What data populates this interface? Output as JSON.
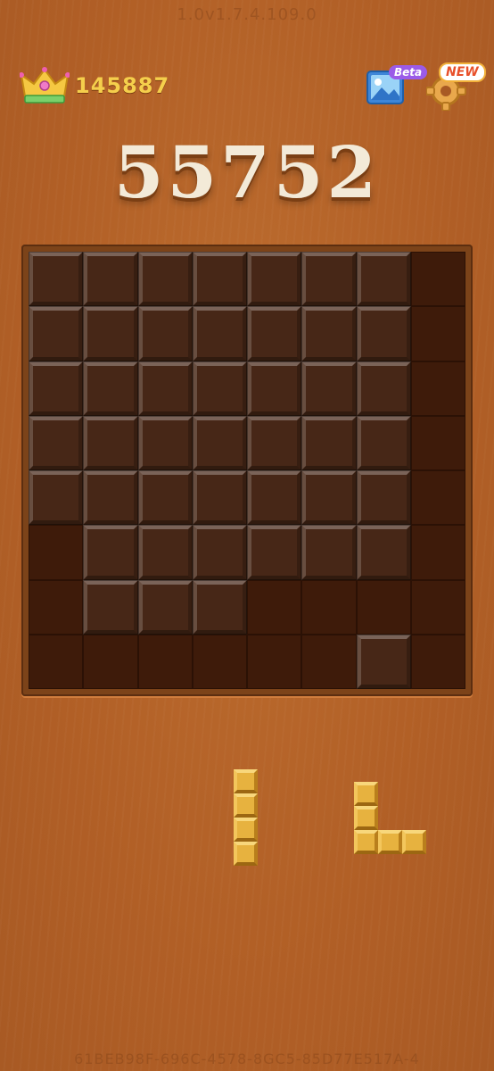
{
  "header": {
    "version": "1.0v1.7.4.109.0",
    "best_score": "145887",
    "photo_badge": "Beta",
    "settings_badge": "NEW"
  },
  "game": {
    "score": "55752",
    "grid_size": 8,
    "filled_cells": [
      [
        0,
        0
      ],
      [
        0,
        1
      ],
      [
        0,
        2
      ],
      [
        0,
        3
      ],
      [
        0,
        4
      ],
      [
        0,
        5
      ],
      [
        0,
        6
      ],
      [
        1,
        0
      ],
      [
        1,
        1
      ],
      [
        1,
        2
      ],
      [
        1,
        3
      ],
      [
        1,
        4
      ],
      [
        1,
        5
      ],
      [
        1,
        6
      ],
      [
        2,
        0
      ],
      [
        2,
        1
      ],
      [
        2,
        2
      ],
      [
        2,
        3
      ],
      [
        2,
        4
      ],
      [
        2,
        5
      ],
      [
        2,
        6
      ],
      [
        3,
        0
      ],
      [
        3,
        1
      ],
      [
        3,
        2
      ],
      [
        3,
        3
      ],
      [
        3,
        4
      ],
      [
        3,
        5
      ],
      [
        3,
        6
      ],
      [
        4,
        0
      ],
      [
        4,
        1
      ],
      [
        4,
        2
      ],
      [
        4,
        3
      ],
      [
        4,
        4
      ],
      [
        4,
        5
      ],
      [
        4,
        6
      ],
      [
        5,
        1
      ],
      [
        5,
        2
      ],
      [
        5,
        3
      ],
      [
        5,
        4
      ],
      [
        5,
        5
      ],
      [
        5,
        6
      ],
      [
        6,
        1
      ],
      [
        6,
        2
      ],
      [
        6,
        3
      ],
      [
        7,
        6
      ]
    ],
    "pieces": [
      {
        "name": "i-piece-vertical",
        "cells": [
          [
            0,
            0
          ],
          [
            1,
            0
          ],
          [
            2,
            0
          ],
          [
            3,
            0
          ]
        ]
      },
      {
        "name": "l-piece",
        "cells": [
          [
            0,
            0
          ],
          [
            1,
            0
          ],
          [
            2,
            0
          ],
          [
            2,
            1
          ],
          [
            2,
            2
          ]
        ]
      }
    ]
  },
  "footer": {
    "device_id": "61BEB98F-696C-4578-8GC5-85D77E517A-4"
  },
  "colors": {
    "background": "#b5652a",
    "board": "#3c1a09",
    "piece": "#e7b23f",
    "score": "#f3ead8",
    "best_score": "#f5cf4c"
  }
}
